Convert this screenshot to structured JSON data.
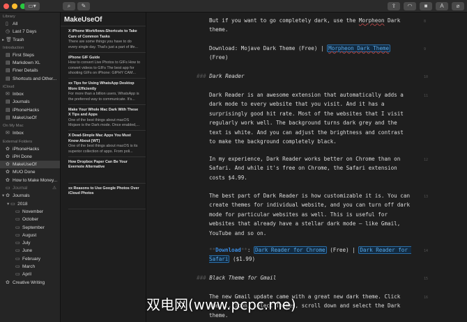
{
  "toolbar": {
    "left": [
      "sidebar-toggle",
      "search",
      "compose"
    ],
    "right": [
      "share",
      "stats",
      "sidebar",
      "font",
      "attach"
    ],
    "font_label": "A"
  },
  "sidebar": {
    "sections": [
      {
        "label": "Library",
        "items": [
          "All",
          "Last 7 Days",
          "Trash"
        ]
      },
      {
        "label": "Introduction",
        "items": [
          "First Steps",
          "Markdown XL",
          "Finer Details",
          "Shortcuts and Other..."
        ]
      },
      {
        "label": "iCloud",
        "items": [
          "Inbox",
          "Journals",
          "iPhoneHacks",
          "MakeUseOf"
        ]
      },
      {
        "label": "On My Mac",
        "items": [
          "Inbox"
        ]
      },
      {
        "label": "External Folders",
        "items": [
          "iPhoneHacks",
          "iPH Done",
          "MakeUseOf",
          "MUO Done",
          "How to Make Money...",
          "Journal",
          "Journals",
          "2018",
          "November",
          "October",
          "September",
          "August",
          "July",
          "June",
          "February",
          "March",
          "April",
          "Creative Writing"
        ]
      }
    ],
    "selected": "MakeUseOf"
  },
  "list": {
    "title": "MakeUseOf",
    "notes": [
      {
        "title": "X iPhone Workflows-Shortcuts to Take Care of Common Tasks",
        "preview": "There are some things you have to do every single day. That's just a part of life..."
      },
      {
        "title": "iPhone GIF Guide",
        "preview": "How to convert Live Photos to GIFs How to convert videos to GIFs The best app for shooting GIFs on iPhone: GIPHY CAM..."
      },
      {
        "title": "xx Tips for Using WhatsApp Desktop More Efficiently",
        "preview": "For more than a billion users, WhatsApp is the preferred way to communicate. It's..."
      },
      {
        "title": "Make Your Whole Mac Dark With These X Tips and Apps",
        "preview": "One of the best things about macOS Mojave is the Dark mode. Once enabled,..."
      },
      {
        "title": "X Dead-Simple Mac Apps You Must Know About [WT]",
        "preview": "One of the best things about macOS is its superior collection of apps. From poli..."
      },
      {
        "title": "How Dropbox Paper Can Be Your Evernote Alternative",
        "preview": ""
      },
      {
        "title": "xx Reasons to Use Google Photos Over iCloud Photos",
        "preview": ""
      }
    ]
  },
  "editor": {
    "p8a": "But if you want to go completely dark, use the ",
    "p8b": "Morpheon",
    " p8c": " Dark theme.",
    "p9a": "Download: Mojave Dark Theme (Free) | ",
    "p9link": "Morpheon Dark Theme",
    "p9b": " (Free)",
    "hash": "###",
    "h10": "Dark Reader",
    "p11": "Dark Reader is an awesome extension that automatically adds a dark mode to every website that you visit. And it has a surprisingly good hit rate. Most of the websites that I visit regularly work well. The background turns dark grey and the text is white. And you can adjust the brightness and contrast to make the background completely black.",
    "p12": "In my experience, Dark Reader works better on Chrome than on Safari. And while it's free on Chrome, the Safari extension costs $4.99.",
    "p13": "The best part of Dark Reader is how customizable it is. You can create themes for individual website, and you can turn off dark mode for particular websites as well. This is useful for websites that already have a stellar dark mode – like Gmail, YouTube and so on.",
    "p14stars": "**",
    "p14dl": "Download",
    "p14colon": ": ",
    "p14l1": "Dark Reader for Chrome",
    "p14mid": " (Free) | ",
    "p14l2": "Dark Reader for Safari",
    "p14end": " ($1.99)",
    "h15": "Black Theme for Gmail",
    "p16": "The new Gmail update came with a great new dark theme. Click the ... icon, select Themes, scroll down and select the Dark theme.",
    "line_numbers": [
      "8",
      "9",
      "10",
      "11",
      "12",
      "13",
      "14",
      "15",
      "16"
    ]
  },
  "watermark": "双电网(www.pcpc.me)"
}
